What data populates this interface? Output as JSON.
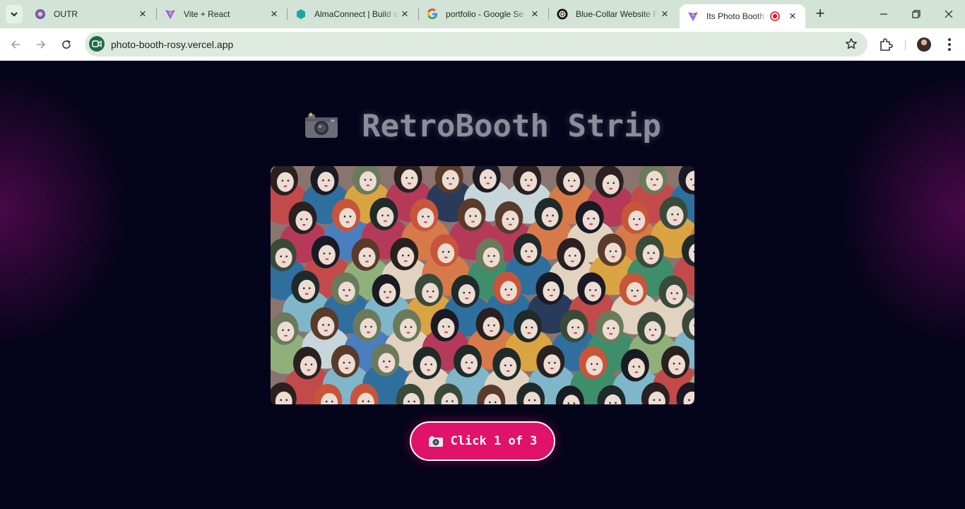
{
  "browser": {
    "tabs": [
      {
        "title": "OUTR",
        "favicon": "outr-favicon-icon",
        "active": false
      },
      {
        "title": "Vite + React",
        "favicon": "vite-favicon-icon",
        "active": false
      },
      {
        "title": "AlmaConnect | Build a",
        "favicon": "almaconnect-favicon-icon",
        "active": false
      },
      {
        "title": "portfolio - Google Se",
        "favicon": "google-favicon-icon",
        "active": false
      },
      {
        "title": "Blue-Collar Website F",
        "favicon": "openai-favicon-icon",
        "active": false
      },
      {
        "title": "Its Photo Booth ti",
        "favicon": "vite-favicon-icon",
        "active": true,
        "recording": true
      }
    ],
    "url": "photo-booth-rosy.vercel.app"
  },
  "page": {
    "title": "RetroBooth Strip",
    "title_icon": "camera-icon",
    "capture_button": {
      "label": "Click 1 of 3",
      "icon": "camera-icon",
      "current_shot": 1,
      "total_shots": 3
    }
  },
  "colors": {
    "page_background": "#04041a",
    "glow": "#5f0a55",
    "button": "#e0126a",
    "title_text": "#8b8d99",
    "tab_strip": "#d3e3d5",
    "omnibox": "#deeadf"
  }
}
